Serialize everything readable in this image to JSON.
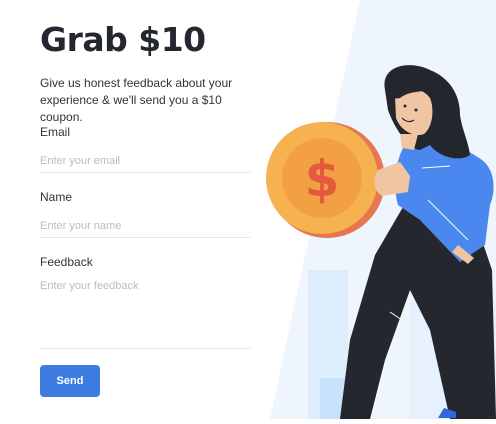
{
  "header": {
    "title": "Grab $10",
    "subtitle": "Give us honest feedback about your experience & we'll send you a $10 coupon."
  },
  "form": {
    "email": {
      "label": "Email",
      "placeholder": "Enter your email",
      "value": ""
    },
    "name": {
      "label": "Name",
      "placeholder": "Enter your name",
      "value": ""
    },
    "feedback": {
      "label": "Feedback",
      "placeholder": "Enter your feedback",
      "value": ""
    },
    "submit_label": "Send"
  },
  "illustration": {
    "coin_symbol": "$",
    "icons": [
      "coin-icon",
      "woman-figure"
    ]
  },
  "colors": {
    "accent": "#3e7be0",
    "coin": "#f6b24f",
    "coin_symbol": "#e35a3c",
    "shirt": "#4a88f0",
    "hair": "#23262c",
    "background_tint": "#eef5fd"
  }
}
